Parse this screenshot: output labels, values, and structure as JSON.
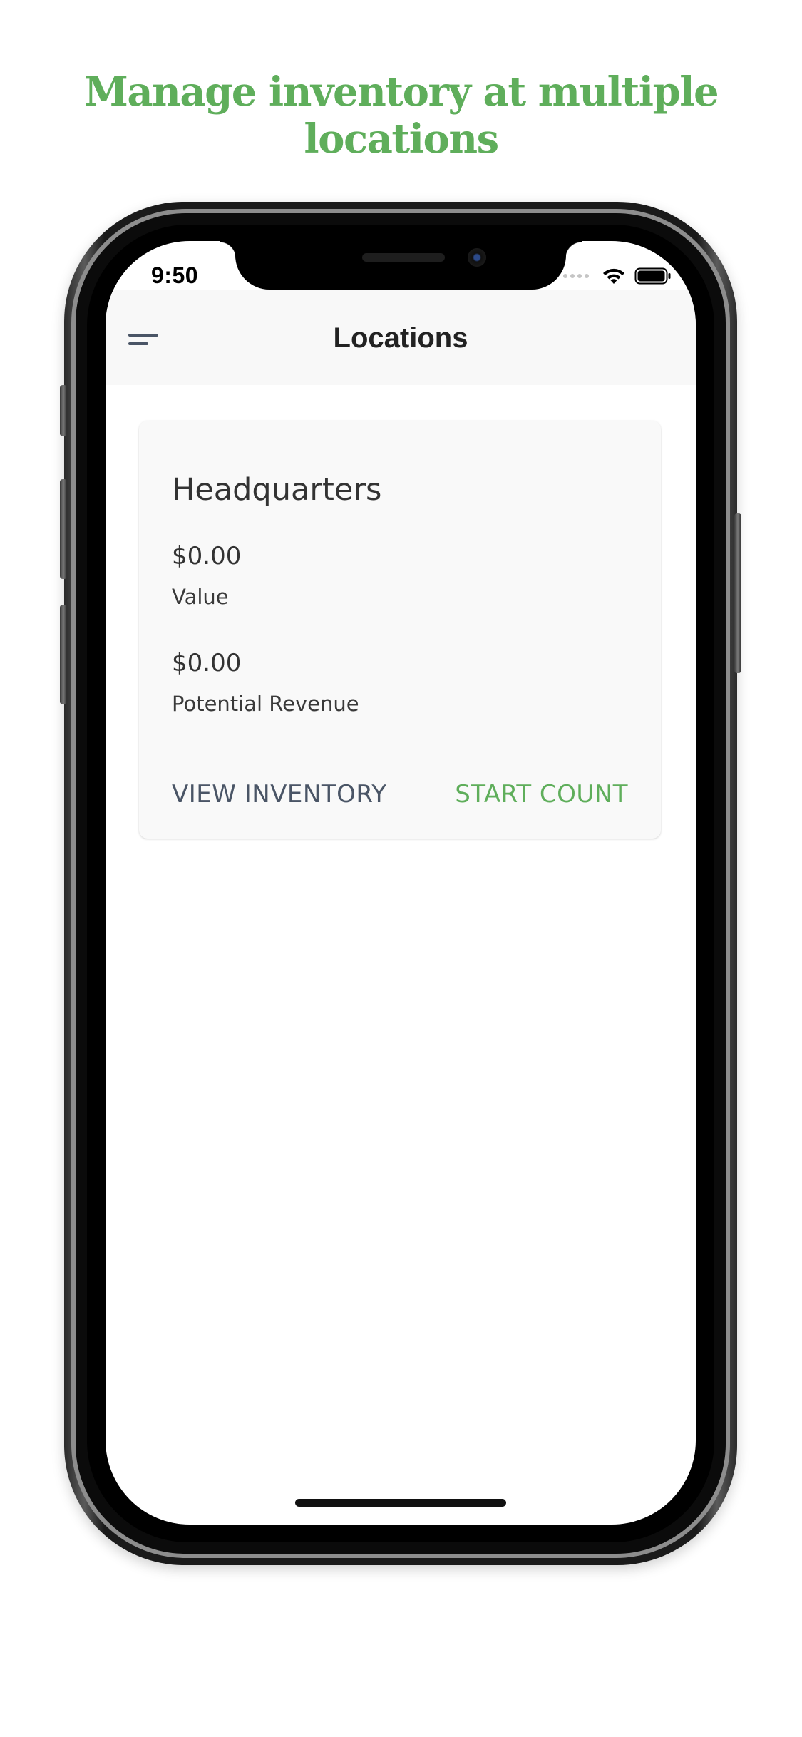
{
  "headline": "Manage inventory at multiple locations",
  "colors": {
    "accent_green": "#5fae5b",
    "secondary_button": "#4a5566",
    "navbar_bg": "#f8f8f8",
    "card_bg": "#f9f9f9"
  },
  "status_bar": {
    "time": "9:50",
    "icons": [
      "signal-dots-icon",
      "wifi-icon",
      "battery-icon"
    ]
  },
  "navbar": {
    "menu_icon": "menu-icon",
    "title": "Locations"
  },
  "location_card": {
    "name": "Headquarters",
    "value_amount": "$0.00",
    "value_label": "Value",
    "revenue_amount": "$0.00",
    "revenue_label": "Potential Revenue",
    "view_inventory_label": "VIEW INVENTORY",
    "start_count_label": "START COUNT"
  }
}
